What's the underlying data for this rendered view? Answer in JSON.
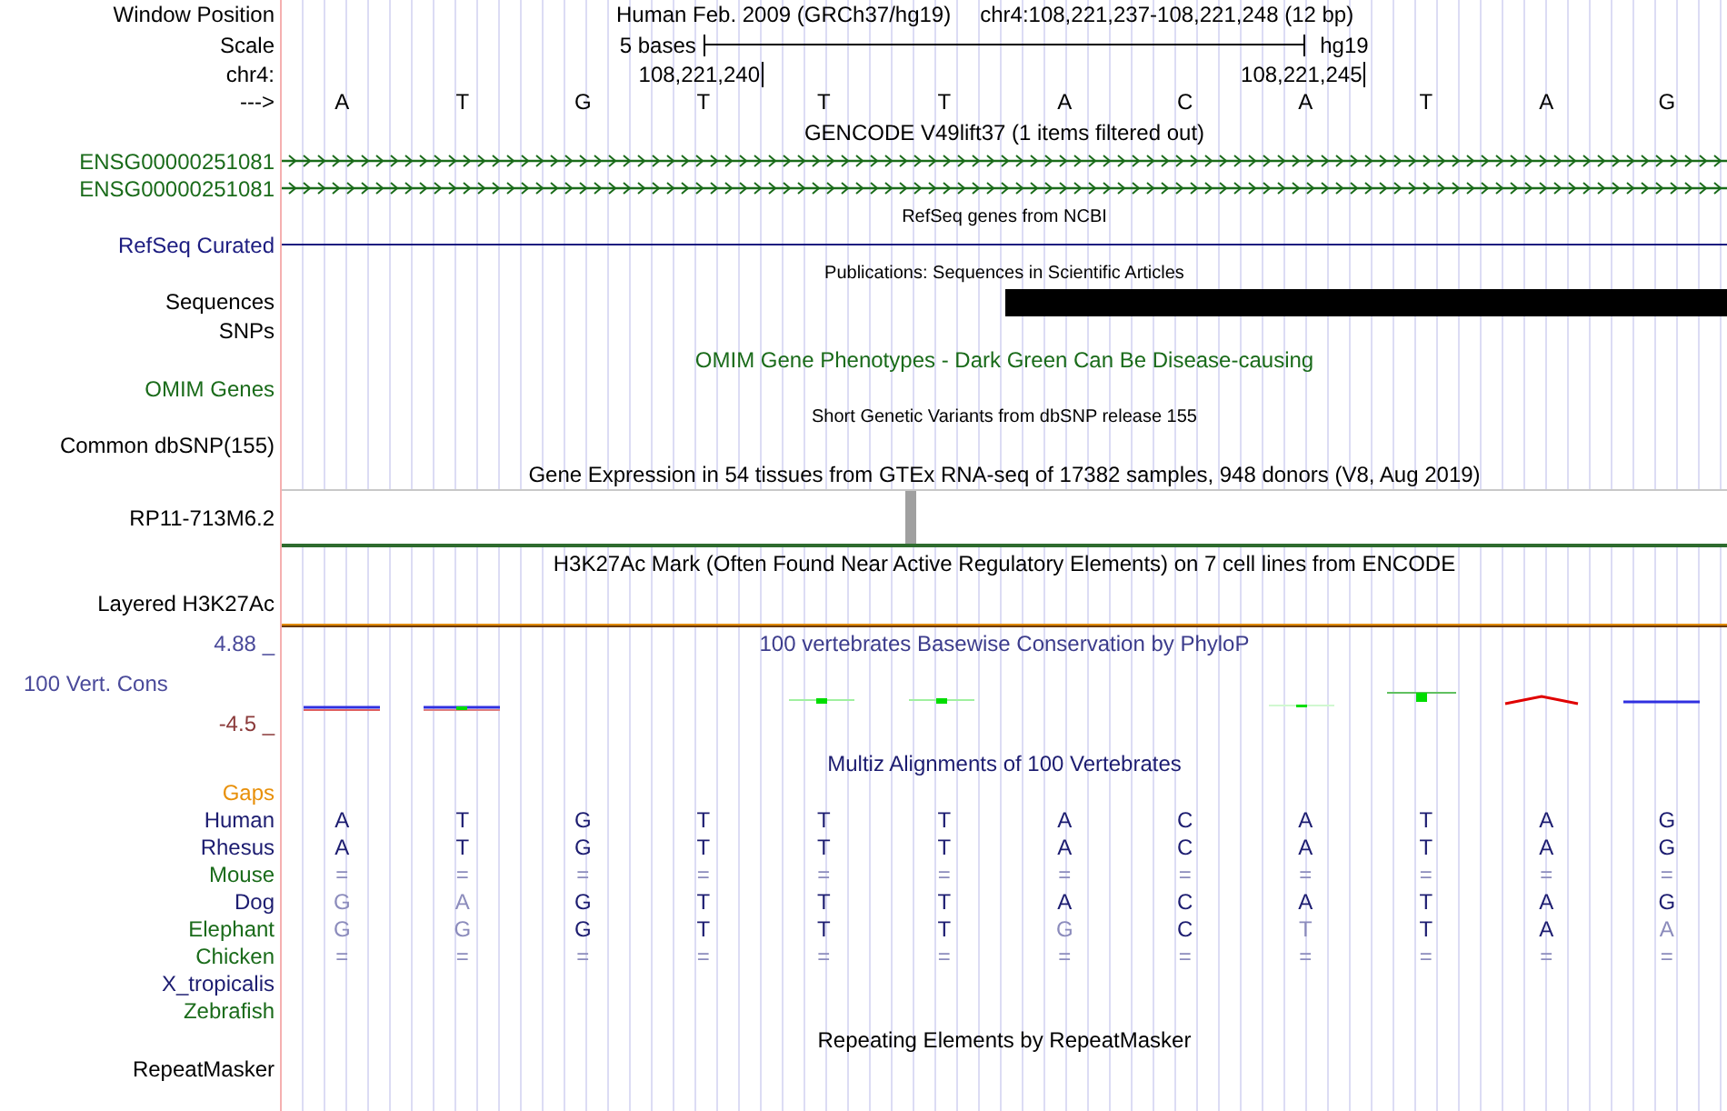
{
  "rows": [
    {
      "kind": "position",
      "label": "Window Position",
      "assembly": "Human Feb. 2009 (GRCh37/hg19)",
      "range": "chr4:108,221,237-108,221,248 (12 bp)"
    },
    {
      "kind": "scale",
      "label": "Scale",
      "span": "5 bases",
      "db": "hg19"
    },
    {
      "kind": "coords",
      "label": "chr4:",
      "ticks": [
        "108,221,240",
        "108,221,245"
      ]
    },
    {
      "kind": "bases",
      "label": "--->",
      "bases": [
        "A",
        "T",
        "G",
        "T",
        "T",
        "T",
        "A",
        "C",
        "A",
        "T",
        "A",
        "G"
      ]
    },
    {
      "kind": "title",
      "title": "GENCODE V49lift37 (1 items filtered out)",
      "color": "#000000"
    },
    {
      "kind": "gene",
      "label": "ENSG00000251081",
      "color": "#1a6b1a"
    },
    {
      "kind": "gene",
      "label": "ENSG00000251081",
      "color": "#1a6b1a"
    },
    {
      "kind": "subtitle",
      "title": "RefSeq genes from NCBI"
    },
    {
      "kind": "line",
      "label": "RefSeq Curated",
      "color": "#1c1c80"
    },
    {
      "kind": "subtitle",
      "title": "Publications: Sequences in Scientific Articles"
    },
    {
      "kind": "block",
      "label": "Sequences",
      "color": "#000000"
    },
    {
      "kind": "empty",
      "label": "SNPs",
      "color": "#000000"
    },
    {
      "kind": "title",
      "title": "OMIM Gene Phenotypes - Dark Green Can Be Disease-causing",
      "color": "#1a6b1a"
    },
    {
      "kind": "empty",
      "label": "OMIM Genes",
      "color": "#1a6b1a"
    },
    {
      "kind": "subtitle",
      "title": "Short Genetic Variants from dbSNP release 155"
    },
    {
      "kind": "empty",
      "label": "Common dbSNP(155)",
      "color": "#000000"
    },
    {
      "kind": "title",
      "title": "Gene Expression in 54 tissues from GTEx RNA-seq of 17382 samples, 948 donors (V8, Aug 2019)",
      "color": "#000000"
    },
    {
      "kind": "expression",
      "label": "RP11-713M6.2"
    },
    {
      "kind": "title",
      "title": "H3K27Ac Mark (Often Found Near Active Regulatory Elements) on 7 cell lines from ENCODE",
      "color": "#000000"
    },
    {
      "kind": "layered",
      "label": "Layered H3K27Ac"
    },
    {
      "kind": "conservation",
      "title": "100 vertebrates Basewise Conservation by PhyloP",
      "label": "100 Vert. Cons",
      "max": "4.88 _",
      "min": "-4.5 _"
    },
    {
      "kind": "title",
      "title": "Multiz Alignments of 100 Vertebrates",
      "color": "#1c1c70"
    },
    {
      "kind": "empty",
      "label": "Gaps",
      "color": "#e8900a"
    },
    {
      "kind": "species",
      "label": "Human",
      "color": "#1c1c70",
      "bases": [
        {
          "base": "A",
          "faded": false
        },
        {
          "base": "T",
          "faded": false
        },
        {
          "base": "G",
          "faded": false
        },
        {
          "base": "T",
          "faded": false
        },
        {
          "base": "T",
          "faded": false
        },
        {
          "base": "T",
          "faded": false
        },
        {
          "base": "A",
          "faded": false
        },
        {
          "base": "C",
          "faded": false
        },
        {
          "base": "A",
          "faded": false
        },
        {
          "base": "T",
          "faded": false
        },
        {
          "base": "A",
          "faded": false
        },
        {
          "base": "G",
          "faded": false
        }
      ]
    },
    {
      "kind": "species",
      "label": "Rhesus",
      "color": "#1c1c70",
      "bases": [
        {
          "base": "A",
          "faded": false
        },
        {
          "base": "T",
          "faded": false
        },
        {
          "base": "G",
          "faded": false
        },
        {
          "base": "T",
          "faded": false
        },
        {
          "base": "T",
          "faded": false
        },
        {
          "base": "T",
          "faded": false
        },
        {
          "base": "A",
          "faded": false
        },
        {
          "base": "C",
          "faded": false
        },
        {
          "base": "A",
          "faded": false
        },
        {
          "base": "T",
          "faded": false
        },
        {
          "base": "A",
          "faded": false
        },
        {
          "base": "G",
          "faded": false
        }
      ]
    },
    {
      "kind": "species",
      "label": "Mouse",
      "color": "#1a6b1a",
      "bases": [
        {
          "base": "=",
          "faded": true
        },
        {
          "base": "=",
          "faded": true
        },
        {
          "base": "=",
          "faded": true
        },
        {
          "base": "=",
          "faded": true
        },
        {
          "base": "=",
          "faded": true
        },
        {
          "base": "=",
          "faded": true
        },
        {
          "base": "=",
          "faded": true
        },
        {
          "base": "=",
          "faded": true
        },
        {
          "base": "=",
          "faded": true
        },
        {
          "base": "=",
          "faded": true
        },
        {
          "base": "=",
          "faded": true
        },
        {
          "base": "=",
          "faded": true
        }
      ]
    },
    {
      "kind": "species",
      "label": "Dog",
      "color": "#1c1c70",
      "bases": [
        {
          "base": "G",
          "faded": true
        },
        {
          "base": "A",
          "faded": true
        },
        {
          "base": "G",
          "faded": false
        },
        {
          "base": "T",
          "faded": false
        },
        {
          "base": "T",
          "faded": false
        },
        {
          "base": "T",
          "faded": false
        },
        {
          "base": "A",
          "faded": false
        },
        {
          "base": "C",
          "faded": false
        },
        {
          "base": "A",
          "faded": false
        },
        {
          "base": "T",
          "faded": false
        },
        {
          "base": "A",
          "faded": false
        },
        {
          "base": "G",
          "faded": false
        }
      ]
    },
    {
      "kind": "species",
      "label": "Elephant",
      "color": "#1a6b1a",
      "bases": [
        {
          "base": "G",
          "faded": true
        },
        {
          "base": "G",
          "faded": true
        },
        {
          "base": "G",
          "faded": false
        },
        {
          "base": "T",
          "faded": false
        },
        {
          "base": "T",
          "faded": false
        },
        {
          "base": "T",
          "faded": false
        },
        {
          "base": "G",
          "faded": true
        },
        {
          "base": "C",
          "faded": false
        },
        {
          "base": "T",
          "faded": true
        },
        {
          "base": "T",
          "faded": false
        },
        {
          "base": "A",
          "faded": false
        },
        {
          "base": "A",
          "faded": true
        }
      ]
    },
    {
      "kind": "species",
      "label": "Chicken",
      "color": "#1a6b1a",
      "bases": [
        {
          "base": "=",
          "faded": true
        },
        {
          "base": "=",
          "faded": true
        },
        {
          "base": "=",
          "faded": true
        },
        {
          "base": "=",
          "faded": true
        },
        {
          "base": "=",
          "faded": true
        },
        {
          "base": "=",
          "faded": true
        },
        {
          "base": "=",
          "faded": true
        },
        {
          "base": "=",
          "faded": true
        },
        {
          "base": "=",
          "faded": true
        },
        {
          "base": "=",
          "faded": true
        },
        {
          "base": "=",
          "faded": true
        },
        {
          "base": "=",
          "faded": true
        }
      ]
    },
    {
      "kind": "species",
      "label": "X_tropicalis",
      "color": "#1c1c70"
    },
    {
      "kind": "species",
      "label": "Zebrafish",
      "color": "#1a6b1a"
    },
    {
      "kind": "title",
      "title": "Repeating Elements by RepeatMasker",
      "color": "#000000"
    },
    {
      "kind": "empty",
      "label": "RepeatMasker",
      "color": "#000000"
    }
  ]
}
